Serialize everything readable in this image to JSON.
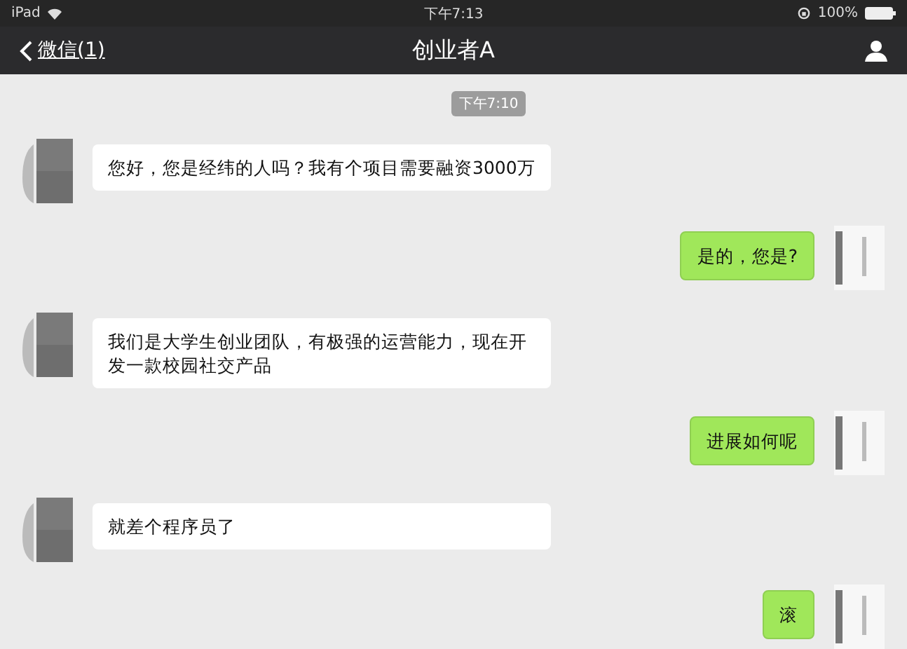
{
  "status_bar": {
    "device": "iPad",
    "time": "下午7:13",
    "battery": "100%"
  },
  "nav_bar": {
    "back": "微信(1)",
    "title": "创业者A"
  },
  "chat": {
    "timestamp": "下午7:10",
    "messages": [
      {
        "kind": "received",
        "text": "您好，您是经纬的人吗？我有个项目需要融资3000万"
      },
      {
        "kind": "sent",
        "text": "是的，您是?"
      },
      {
        "kind": "received",
        "text": "我们是大学生创业团队，有极强的运营能力，现在开发一款校园社交产品"
      },
      {
        "kind": "sent",
        "text": "进展如何呢"
      },
      {
        "kind": "received",
        "text": "就差个程序员了"
      },
      {
        "kind": "sent",
        "text": "滚"
      }
    ]
  }
}
